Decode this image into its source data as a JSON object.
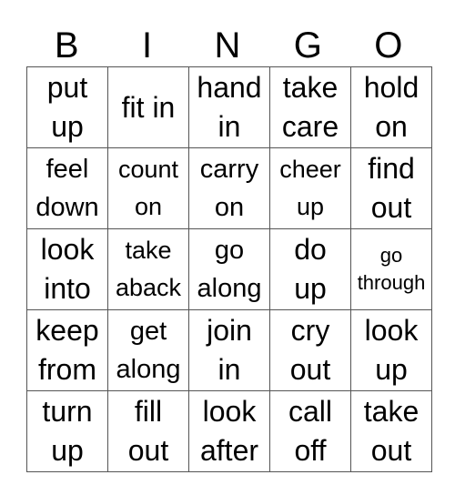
{
  "header": [
    "B",
    "I",
    "N",
    "G",
    "O"
  ],
  "rows": [
    [
      {
        "lines": [
          "put",
          "up"
        ],
        "size": "fs32"
      },
      {
        "lines": [
          "fit in"
        ],
        "size": "fs32"
      },
      {
        "lines": [
          "hand",
          "in"
        ],
        "size": "fs32"
      },
      {
        "lines": [
          "take",
          "care"
        ],
        "size": "fs32"
      },
      {
        "lines": [
          "hold",
          "on"
        ],
        "size": "fs32"
      }
    ],
    [
      {
        "lines": [
          "feel",
          "down"
        ],
        "size": "fs29"
      },
      {
        "lines": [
          "count",
          "on"
        ],
        "size": "fs27"
      },
      {
        "lines": [
          "carry",
          "on"
        ],
        "size": "fs29"
      },
      {
        "lines": [
          "cheer",
          "up"
        ],
        "size": "fs27"
      },
      {
        "lines": [
          "find",
          "out"
        ],
        "size": "fs32"
      }
    ],
    [
      {
        "lines": [
          "look",
          "into"
        ],
        "size": "fs32"
      },
      {
        "lines": [
          "take",
          "aback"
        ],
        "size": "fs27"
      },
      {
        "lines": [
          "go",
          "along"
        ],
        "size": "fs29"
      },
      {
        "lines": [
          "do",
          "up"
        ],
        "size": "fs32"
      },
      {
        "lines": [
          "go",
          "through"
        ],
        "size": "fs22"
      }
    ],
    [
      {
        "lines": [
          "keep",
          "from"
        ],
        "size": "fs32"
      },
      {
        "lines": [
          "get",
          "along"
        ],
        "size": "fs29"
      },
      {
        "lines": [
          "join",
          "in"
        ],
        "size": "fs32"
      },
      {
        "lines": [
          "cry",
          "out"
        ],
        "size": "fs32"
      },
      {
        "lines": [
          "look",
          "up"
        ],
        "size": "fs32"
      }
    ],
    [
      {
        "lines": [
          "turn",
          "up"
        ],
        "size": "fs32"
      },
      {
        "lines": [
          "fill",
          "out"
        ],
        "size": "fs32"
      },
      {
        "lines": [
          "look",
          "after"
        ],
        "size": "fs32"
      },
      {
        "lines": [
          "call",
          "off"
        ],
        "size": "fs32"
      },
      {
        "lines": [
          "take",
          "out"
        ],
        "size": "fs32"
      }
    ]
  ]
}
